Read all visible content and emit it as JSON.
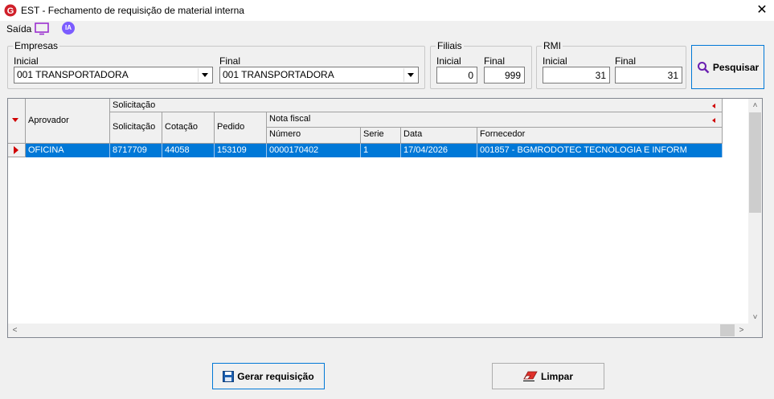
{
  "window": {
    "title": "EST - Fechamento de requisição de material interna",
    "close_glyph": "✕"
  },
  "menu": {
    "saida": "Saída",
    "ia": "IA"
  },
  "empresas": {
    "legend": "Empresas",
    "inicial_label": "Inicial",
    "final_label": "Final",
    "inicial_value": "001 TRANSPORTADORA",
    "final_value": "001 TRANSPORTADORA"
  },
  "filiais": {
    "legend": "Filiais",
    "inicial_label": "Inicial",
    "final_label": "Final",
    "inicial_value": "0",
    "final_value": "999"
  },
  "rmi": {
    "legend": "RMI",
    "inicial_label": "Inicial",
    "final_label": "Final",
    "inicial_value": "31",
    "final_value": "31"
  },
  "buttons": {
    "pesquisar": "Pesquisar",
    "gerar": "Gerar requisição",
    "limpar": "Limpar"
  },
  "grid": {
    "aprovador_header": "Aprovador",
    "solicitacao_group": "Solicitação",
    "nota_fiscal_group": "Nota fiscal",
    "columns": {
      "solicitacao": "Solicitação",
      "cotacao": "Cotação",
      "pedido": "Pedido",
      "numero": "Número",
      "serie": "Serie",
      "data": "Data",
      "fornecedor": "Fornecedor"
    },
    "rows": [
      {
        "aprovador": "OFICINA",
        "solicitacao": "8717709",
        "cotacao": "44058",
        "pedido": "153109",
        "numero": "0000170402",
        "serie": "1",
        "data": "17/04/2026",
        "fornecedor": "001857 - BGMRODOTEC TECNOLOGIA E INFORM"
      }
    ]
  },
  "colors": {
    "selection": "#0078d7",
    "marker": "#d00000",
    "accent": "#7b5cff"
  }
}
